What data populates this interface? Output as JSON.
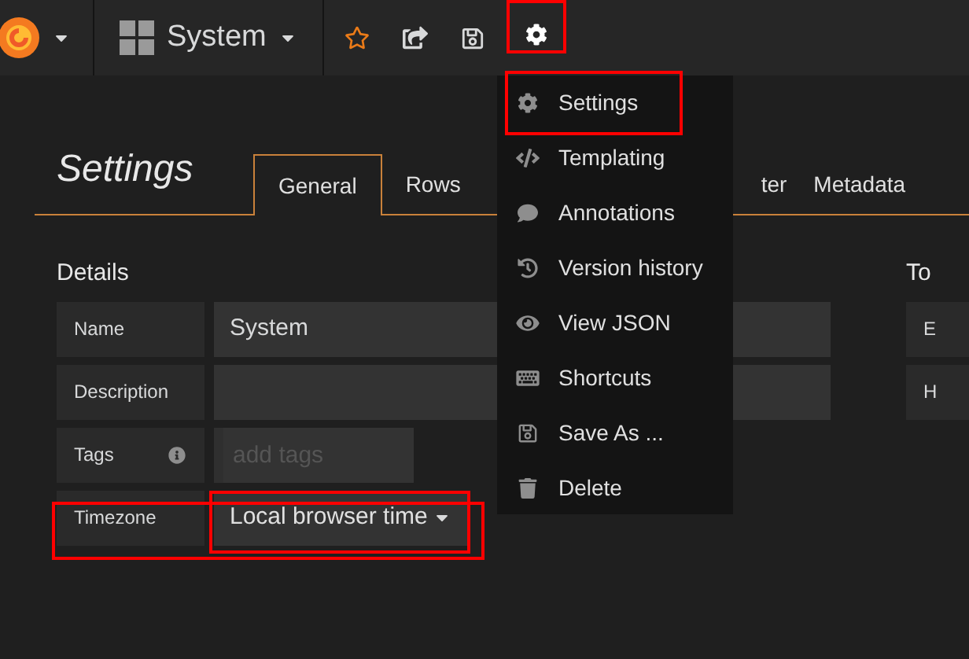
{
  "navbar": {
    "dashboard_title": "System",
    "settings_button": {
      "highlighted": true
    }
  },
  "menu": {
    "items": [
      {
        "kind": "gear",
        "label": "Settings",
        "highlighted": true
      },
      {
        "kind": "code",
        "label": "Templating",
        "highlighted": false
      },
      {
        "kind": "comment",
        "label": "Annotations",
        "highlighted": false
      },
      {
        "kind": "history",
        "label": "Version history",
        "highlighted": false
      },
      {
        "kind": "eye",
        "label": "View JSON",
        "highlighted": false
      },
      {
        "kind": "keyboard",
        "label": "Shortcuts",
        "highlighted": false
      },
      {
        "kind": "save",
        "label": "Save As ...",
        "highlighted": false
      },
      {
        "kind": "trash",
        "label": "Delete",
        "highlighted": false
      }
    ]
  },
  "page_title": "Settings",
  "tabs": [
    {
      "label": "General",
      "selected": true
    },
    {
      "label": "Rows",
      "selected": false
    },
    {
      "label": "ter",
      "selected": false
    },
    {
      "label": "Metadata",
      "selected": false
    }
  ],
  "details": {
    "heading": "Details",
    "rows": [
      {
        "kind": "text",
        "label": "Name",
        "value": "System",
        "highlighted": false
      },
      {
        "kind": "text",
        "label": "Description",
        "highlighted": false
      },
      {
        "kind": "tags",
        "label": "Tags",
        "placeholder": "add tags",
        "highlighted": false
      },
      {
        "kind": "select",
        "label": "Timezone",
        "value": "Local browser time",
        "highlighted": true
      }
    ]
  },
  "side_section": {
    "heading": "To",
    "rows": [
      "E",
      "H"
    ]
  }
}
